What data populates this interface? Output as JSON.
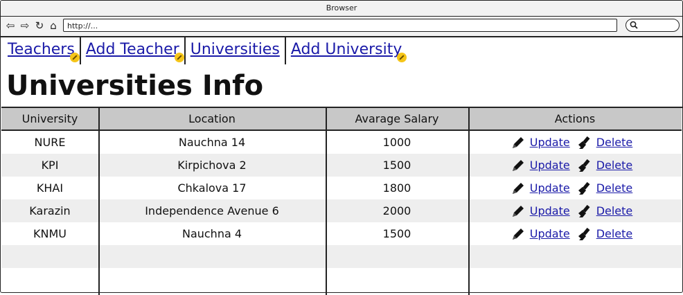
{
  "window": {
    "title": "Browser"
  },
  "toolbar": {
    "url": "http://..."
  },
  "nav": {
    "links": [
      {
        "label": "Teachers"
      },
      {
        "label": "Add Teacher"
      },
      {
        "label": "Universities"
      },
      {
        "label": "Add University"
      }
    ]
  },
  "page": {
    "title": "Universities Info"
  },
  "table": {
    "headers": [
      "University",
      "Location",
      "Avarage Salary",
      "Actions"
    ],
    "rows": [
      {
        "university": "NURE",
        "location": "Nauchna 14",
        "salary": "1000",
        "update": "Update",
        "delete": "Delete"
      },
      {
        "university": "KPI",
        "location": "Kirpichova 2",
        "salary": "1500",
        "update": "Update",
        "delete": "Delete"
      },
      {
        "university": "KHAI",
        "location": "Chkalova 17",
        "salary": "1800",
        "update": "Update",
        "delete": "Delete"
      },
      {
        "university": "Karazin",
        "location": "Independence Avenue 6",
        "salary": "2000",
        "update": "Update",
        "delete": "Delete"
      },
      {
        "university": "KNMU",
        "location": "Nauchna 4",
        "salary": "1500",
        "update": "Update",
        "delete": "Delete"
      }
    ]
  },
  "colors": {
    "link": "#1a1aa8",
    "header_bg": "#c8c8c8",
    "alt_row_bg": "#eeeeee",
    "badge": "#f5c518"
  }
}
